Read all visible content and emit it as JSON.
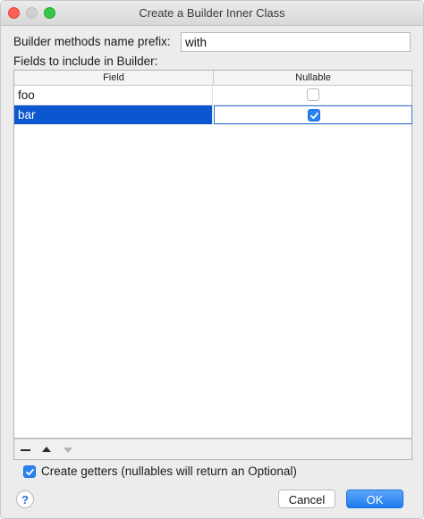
{
  "window": {
    "title": "Create a Builder Inner Class"
  },
  "form": {
    "prefix_label": "Builder methods name prefix:",
    "prefix_value": "with",
    "fields_label": "Fields to include in Builder:"
  },
  "table": {
    "columns": [
      "Field",
      "Nullable"
    ],
    "rows": [
      {
        "field": "foo",
        "nullable": false,
        "selected": false
      },
      {
        "field": "bar",
        "nullable": true,
        "selected": true
      }
    ]
  },
  "toolbar": {
    "icons": [
      "minus-icon",
      "arrow-up-icon",
      "arrow-down-icon"
    ]
  },
  "options": {
    "create_getters_label": "Create getters (nullables will return an Optional)",
    "create_getters_checked": true
  },
  "footer": {
    "help_label": "?",
    "cancel_label": "Cancel",
    "ok_label": "OK"
  },
  "colors": {
    "selection": "#0c56d0",
    "accent": "#2a82f0"
  }
}
